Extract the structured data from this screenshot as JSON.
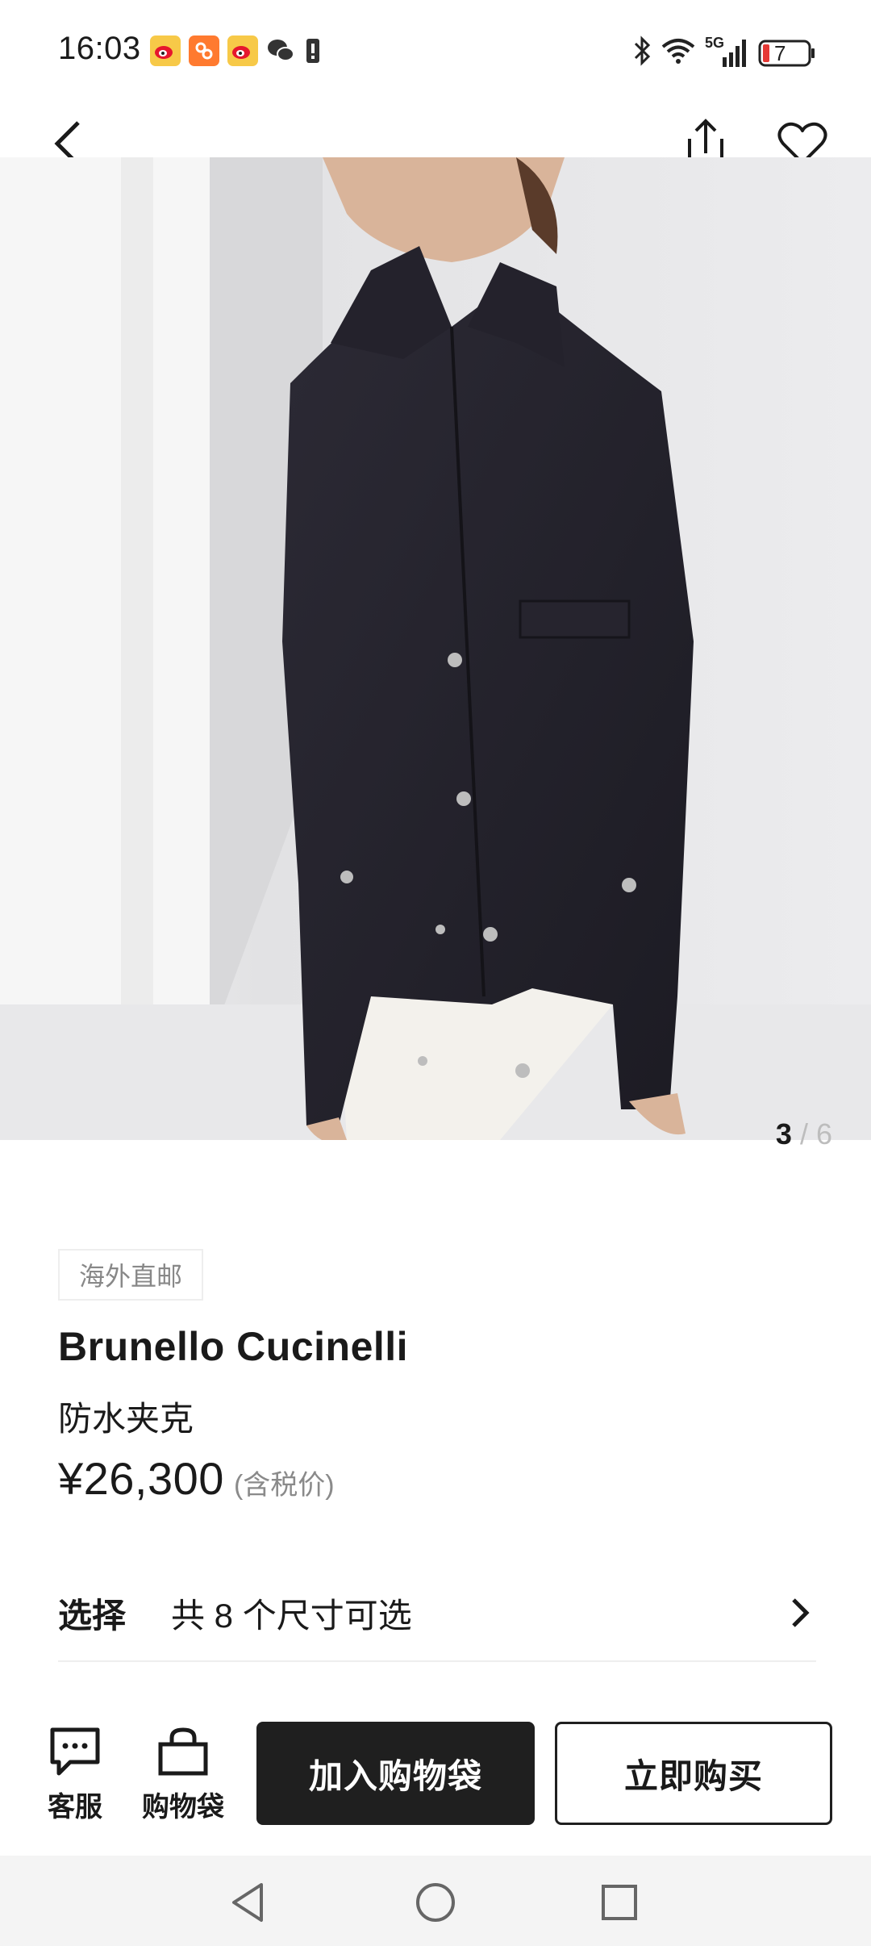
{
  "status_bar": {
    "time": "16:03",
    "network": "5G",
    "battery": "7",
    "notification_icons": [
      "weibo-icon",
      "ctrip-icon",
      "weibo-icon",
      "wechat-icon",
      "alert-icon"
    ]
  },
  "nav": {
    "back_icon": "chevron-left-icon",
    "share_icon": "share-icon",
    "favorite_icon": "heart-icon"
  },
  "gallery": {
    "current": "3",
    "separator": "/",
    "total": "6"
  },
  "product": {
    "tag": "海外直邮",
    "brand": "Brunello Cucinelli",
    "name": "防水夹克",
    "price": "¥26,300",
    "tax_note": "(含税价)"
  },
  "selection": {
    "label": "选择",
    "value": "共 8 个尺寸可选"
  },
  "actions": {
    "service_label": "客服",
    "bag_label": "购物袋",
    "add_to_bag": "加入购物袋",
    "buy_now": "立即购买"
  },
  "colors": {
    "primary_dark": "#1f1f1f",
    "muted_text": "#8a8a8a",
    "divider": "#eeeeee"
  }
}
